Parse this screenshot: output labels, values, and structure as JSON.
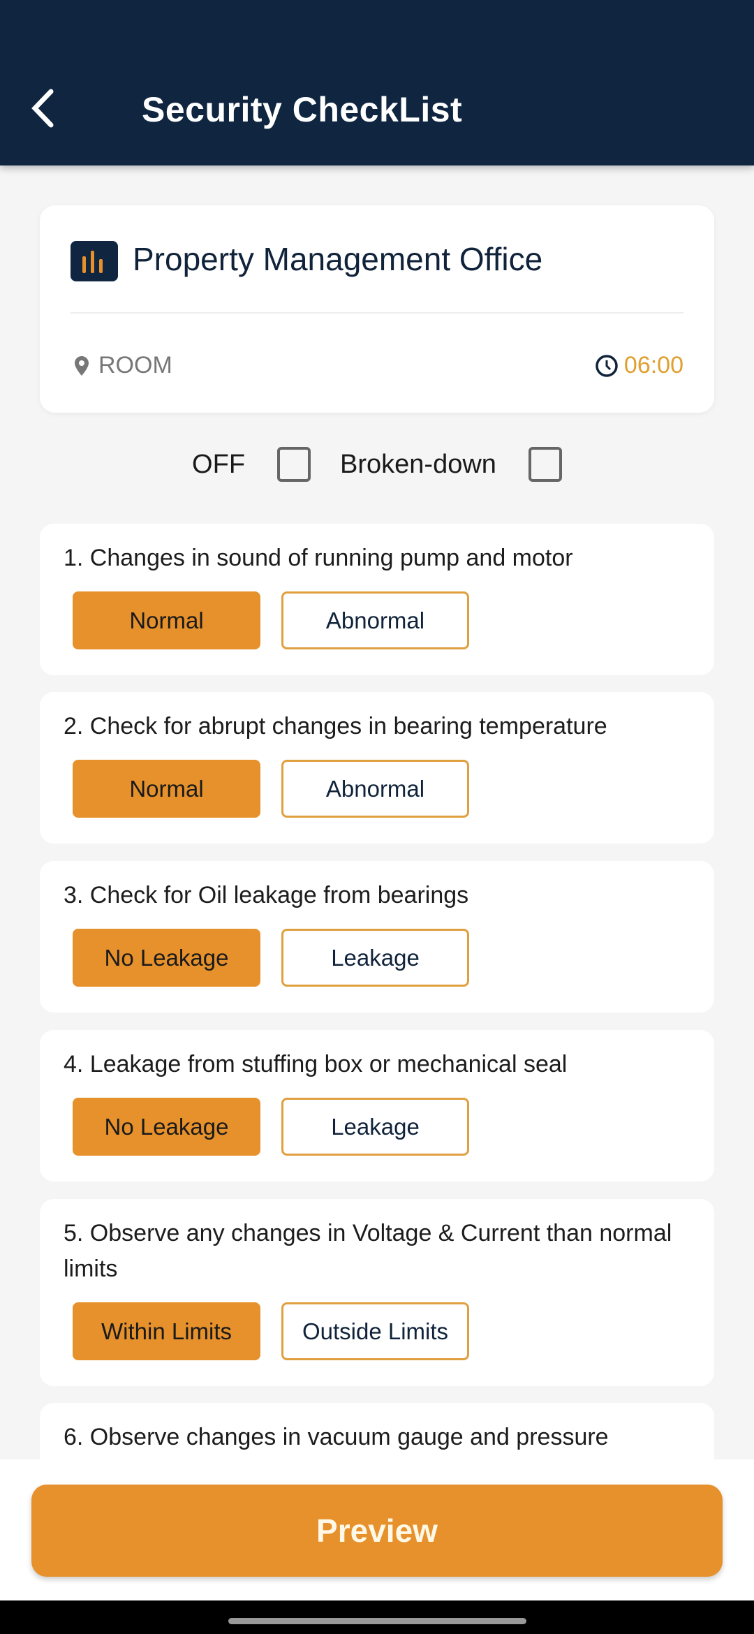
{
  "header": {
    "title": "Security CheckList",
    "back_icon": "chevron-left-icon"
  },
  "location": {
    "name": "Property Management Office",
    "icon": "building-icon",
    "room": "ROOM",
    "time": "06:00"
  },
  "status": {
    "off_label": "OFF",
    "off_checked": false,
    "broken_label": "Broken-down",
    "broken_checked": false
  },
  "questions": [
    {
      "text": "1. Changes in sound of running pump and motor",
      "options": [
        "Normal",
        "Abnormal"
      ],
      "selected": 0
    },
    {
      "text": "2. Check for abrupt changes in bearing temperature",
      "options": [
        "Normal",
        "Abnormal"
      ],
      "selected": 0
    },
    {
      "text": "3. Check for Oil leakage from bearings",
      "options": [
        "No Leakage",
        "Leakage"
      ],
      "selected": 0
    },
    {
      "text": "4. Leakage from stuffing box or mechanical seal",
      "options": [
        "No Leakage",
        "Leakage"
      ],
      "selected": 0
    },
    {
      "text": "5. Observe any changes in Voltage & Current than normal limits",
      "options": [
        "Within Limits",
        "Outside Limits"
      ],
      "selected": 0
    },
    {
      "text": "6. Observe changes in vacuum gauge and pressure"
    }
  ],
  "footer": {
    "preview_label": "Preview"
  },
  "colors": {
    "header": "#0f2540",
    "accent": "#e6912c",
    "time": "#e0a030"
  }
}
